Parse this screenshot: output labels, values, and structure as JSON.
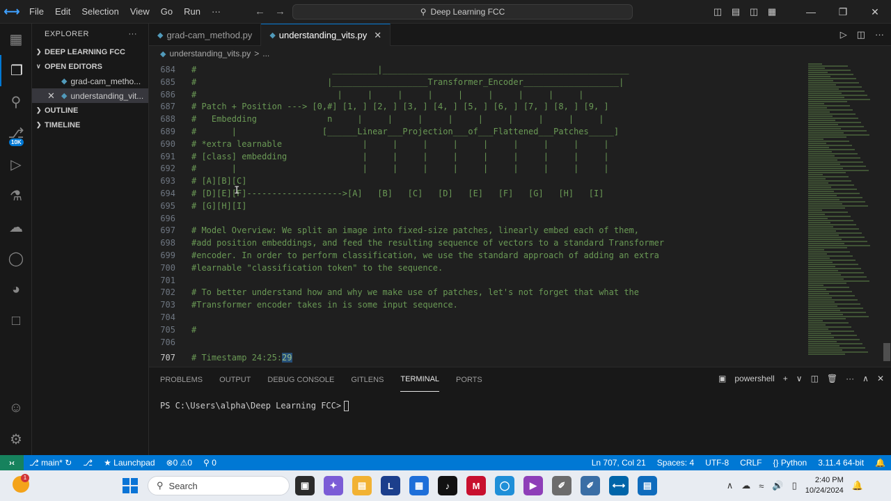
{
  "titlebar": {
    "menu": [
      "File",
      "Edit",
      "Selection",
      "View",
      "Go",
      "Run",
      "···"
    ],
    "command_center": "Deep Learning FCC"
  },
  "sidebar": {
    "title": "EXPLORER",
    "sections": {
      "project": "DEEP LEARNING FCC",
      "open_editors": "OPEN EDITORS",
      "outline": "OUTLINE",
      "timeline": "TIMELINE"
    },
    "files": [
      "grad-cam_metho...",
      "understanding_vit..."
    ],
    "scm_badge": "10K"
  },
  "tabs": [
    {
      "label": "grad-cam_method.py"
    },
    {
      "label": "understanding_vits.py"
    }
  ],
  "breadcrumb": {
    "file": "understanding_vits.py",
    "sep": ">",
    "more": "..."
  },
  "editor": {
    "lines": [
      {
        "n": "684",
        "text": "#                           _________|_________________________________________________"
      },
      {
        "n": "685",
        "text": "#                          |___________________Transformer_Encoder___________________|"
      },
      {
        "n": "686",
        "text": "#                            |     |     |     |     |     |     |     |     |"
      },
      {
        "n": "687",
        "text": "# Patch + Position ---> [0,#] [1, ] [2, ] [3, ] [4, ] [5, ] [6, ] [7, ] [8, ] [9, ]"
      },
      {
        "n": "688",
        "text": "#   Embedding              n     |     |     |     |     |     |     |     |     |"
      },
      {
        "n": "689",
        "text": "#       |                 [______Linear___Projection___of___Flattened___Patches_____]"
      },
      {
        "n": "690",
        "text": "# *extra learnable                |     |     |     |     |     |     |     |     |"
      },
      {
        "n": "691",
        "text": "# [class] embedding               |     |     |     |     |     |     |     |     |"
      },
      {
        "n": "692",
        "text": "#       |                         |     |     |     |     |     |     |     |     |"
      },
      {
        "n": "693",
        "text": "# [A][B][C]"
      },
      {
        "n": "694",
        "text": "# [D][E][F]------------------->[A]   [B]   [C]   [D]   [E]   [F]   [G]   [H]   [I]"
      },
      {
        "n": "695",
        "text": "# [G][H][I]"
      },
      {
        "n": "696",
        "text": ""
      },
      {
        "n": "697",
        "text": "# Model Overview: We split an image into fixed-size patches, linearly embed each of them,"
      },
      {
        "n": "698",
        "text": "#add position embeddings, and feed the resulting sequence of vectors to a standard Transformer"
      },
      {
        "n": "699",
        "text": "#encoder. In order to perform classification, we use the standard approach of adding an extra"
      },
      {
        "n": "700",
        "text": "#learnable \"classification token\" to the sequence."
      },
      {
        "n": "701",
        "text": ""
      },
      {
        "n": "702",
        "text": "# To better understand how and why we make use of patches, let's not forget that what the"
      },
      {
        "n": "703",
        "text": "#Transformer encoder takes in is some input sequence."
      },
      {
        "n": "704",
        "text": ""
      },
      {
        "n": "705",
        "text": "#"
      },
      {
        "n": "706",
        "text": ""
      }
    ],
    "current_line": {
      "n": "707",
      "text": "# Timestamp 24:25:",
      "selected": "29"
    }
  },
  "panel": {
    "tabs": [
      "PROBLEMS",
      "OUTPUT",
      "DEBUG CONSOLE",
      "GITLENS",
      "TERMINAL",
      "PORTS"
    ],
    "shell": "powershell",
    "prompt": "PS C:\\Users\\alpha\\Deep Learning FCC>"
  },
  "statusbar": {
    "branch": "main*",
    "launchpad": "Launchpad",
    "problems": "⊗0 ⚠0",
    "ports": "0",
    "position": "Ln 707, Col 21",
    "spaces": "Spaces: 4",
    "encoding": "UTF-8",
    "eol": "CRLF",
    "language": "Python",
    "interpreter": "3.11.4 64-bit"
  },
  "taskbar": {
    "search_placeholder": "Search",
    "weather_badge": "1",
    "time": "2:40 PM",
    "date": "10/24/2024"
  },
  "colors": {
    "accent": "#0078d4",
    "comment": "#6a9955",
    "remote": "#16825d"
  }
}
